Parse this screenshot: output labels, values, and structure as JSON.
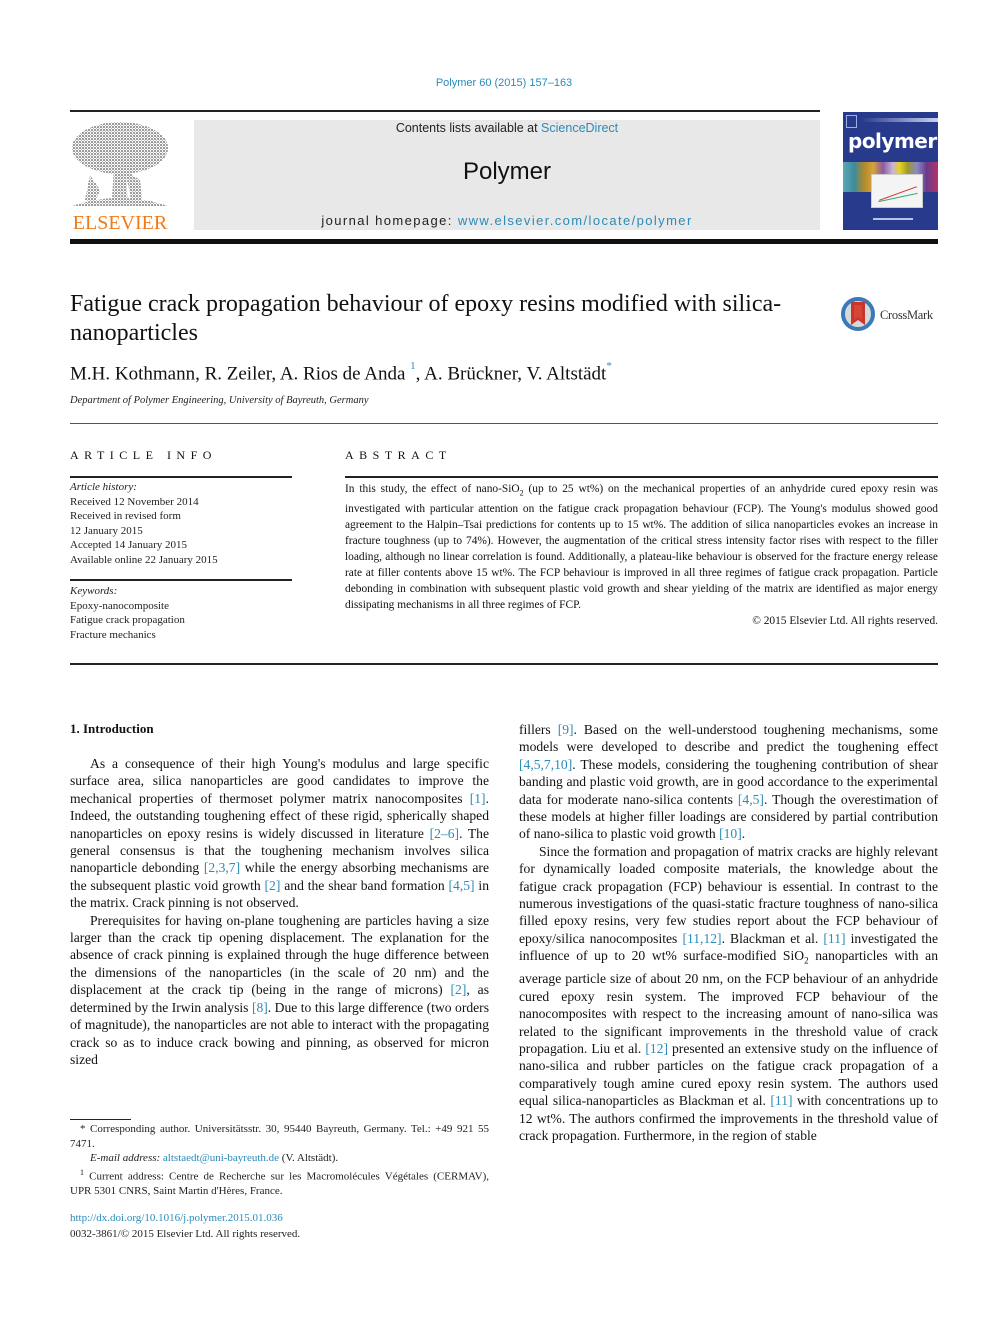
{
  "header": {
    "citation": "Polymer 60 (2015) 157–163",
    "contents_prefix": "Contents lists available at ",
    "contents_link": "ScienceDirect",
    "journal_title": "Polymer",
    "homepage_prefix": "journal homepage: ",
    "homepage_link": "www.elsevier.com/locate/polymer",
    "publisher_logo_text": "ELSEVIER",
    "cover_title": "polymer",
    "colors": {
      "link": "#2a8bb8",
      "elsevier_orange": "#f07a1a",
      "cover_blue": "#283a8c",
      "masthead_bg": "#e8e8e8"
    }
  },
  "article": {
    "title": "Fatigue crack propagation behaviour of epoxy resins modified with silica-nanoparticles",
    "crossmark_label": "CrossMark",
    "authors": [
      {
        "name": "M.H. Kothmann",
        "sup": ""
      },
      {
        "name": "R. Zeiler",
        "sup": ""
      },
      {
        "name": "A. Rios de Anda",
        "sup": "1"
      },
      {
        "name": "A. Brückner",
        "sup": ""
      },
      {
        "name": "V. Altstädt",
        "sup": "*"
      }
    ],
    "author_sep": ", ",
    "affiliation": "Department of Polymer Engineering, University of Bayreuth, Germany"
  },
  "article_info": {
    "heading": "ARTICLE INFO",
    "history_label": "Article history:",
    "history": [
      "Received 12 November 2014",
      "Received in revised form",
      "12 January 2015",
      "Accepted 14 January 2015",
      "Available online 22 January 2015"
    ],
    "keywords_label": "Keywords:",
    "keywords": [
      "Epoxy-nanocomposite",
      "Fatigue crack propagation",
      "Fracture mechanics"
    ]
  },
  "abstract": {
    "heading": "ABSTRACT",
    "text_1": "In this study, the effect of nano-SiO",
    "sub_1": "2",
    "text_2": " (up to 25 wt%) on the mechanical properties of an anhydride cured epoxy resin was investigated with particular attention on the fatigue crack propagation behaviour (FCP). The Young's modulus showed good agreement to the Halpin–Tsai predictions for contents up to 15 wt%. The addition of silica nanoparticles evokes an increase in fracture toughness (up to 74%). However, the augmentation of the critical stress intensity factor rises with respect to the filler loading, although no linear correlation is found. Additionally, a plateau-like behaviour is observed for the fracture energy release rate at filler contents above 15 wt%. The FCP behaviour is improved in all three regimes of fatigue crack propagation. Particle debonding in combination with subsequent plastic void growth and shear yielding of the matrix are identified as major energy dissipating mechanisms in all three regimes of FCP.",
    "copyright": "© 2015 Elsevier Ltd. All rights reserved."
  },
  "body": {
    "section_heading": "1.  Introduction",
    "left_col": {
      "p1": [
        {
          "t": "As a consequence of their high Young's modulus and large specific surface area, silica nanoparticles are good candidates to improve the mechanical properties of thermoset polymer matrix nanocomposites "
        },
        {
          "r": "[1]"
        },
        {
          "t": ". Indeed, the outstanding toughening effect of these rigid, spherically shaped nanoparticles on epoxy resins is widely discussed in literature "
        },
        {
          "r": "[2–6]"
        },
        {
          "t": ". The general consensus is that the toughening mechanism involves silica nanoparticle debonding "
        },
        {
          "r": "[2,3,7]"
        },
        {
          "t": " while the energy absorbing mechanisms are the subsequent plastic void growth "
        },
        {
          "r": "[2]"
        },
        {
          "t": " and the shear band formation "
        },
        {
          "r": "[4,5]"
        },
        {
          "t": " in the matrix. Crack pinning is not observed."
        }
      ],
      "p2": [
        {
          "t": "Prerequisites for having on-plane toughening are particles having a size larger than the crack tip opening displacement. The explanation for the absence of crack pinning is explained through the huge difference between the dimensions of the nanoparticles (in the scale of 20 nm) and the displacement at the crack tip (being in the range of microns) "
        },
        {
          "r": "[2]"
        },
        {
          "t": ", as determined by the Irwin analysis "
        },
        {
          "r": "[8]"
        },
        {
          "t": ". Due to this large difference (two orders of magnitude), the nanoparticles are not able to interact with the propagating crack so as to induce crack bowing and pinning, as observed for micron sized"
        }
      ]
    },
    "right_col": {
      "p1": [
        {
          "t": "fillers "
        },
        {
          "r": "[9]"
        },
        {
          "t": ". Based on the well-understood toughening mechanisms, some models were developed to describe and predict the toughening effect "
        },
        {
          "r": "[4,5,7,10]"
        },
        {
          "t": ". These models, considering the toughening contribution of shear banding and plastic void growth, are in good accordance to the experimental data for moderate nano-silica contents "
        },
        {
          "r": "[4,5]"
        },
        {
          "t": ". Though the overestimation of these models at higher filler loadings are considered by partial contribution of nano-silica to plastic void growth "
        },
        {
          "r": "[10]"
        },
        {
          "t": "."
        }
      ],
      "p2": [
        {
          "t": "Since the formation and propagation of matrix cracks are highly relevant for dynamically loaded composite materials, the knowledge about the fatigue crack propagation (FCP) behaviour is essential. In contrast to the numerous investigations of the quasi-static fracture toughness of nano-silica filled epoxy resins, very few studies report about the FCP behaviour of epoxy/silica nanocomposites "
        },
        {
          "r": "[11,12]"
        },
        {
          "t": ". Blackman et al. "
        },
        {
          "r": "[11]"
        },
        {
          "t": " investigated the influence of up to 20 wt% surface-modified SiO"
        },
        {
          "s": "2"
        },
        {
          "t": " nanoparticles with an average particle size of about 20 nm, on the FCP behaviour of an anhydride cured epoxy resin system. The improved FCP behaviour of the nanocomposites with respect to the increasing amount of nano-silica was related to the significant improvements in the threshold value of crack propagation. Liu et al. "
        },
        {
          "r": "[12]"
        },
        {
          "t": " presented an extensive study on the influence of nano-silica and rubber particles on the fatigue crack propagation of a comparatively tough amine cured epoxy resin system. The authors used equal silica-nanoparticles as Blackman et al. "
        },
        {
          "r": "[11]"
        },
        {
          "t": " with concentrations up to 12 wt%. The authors confirmed the improvements in the threshold value of crack propagation. Furthermore, in the region of stable"
        }
      ]
    }
  },
  "footnotes": {
    "corresponding": "* Corresponding author. Universitätsstr. 30, 95440 Bayreuth, Germany. Tel.: +49 921 55 7471.",
    "email_label": "E-mail address: ",
    "email": "altstaedt@uni-bayreuth.de",
    "email_suffix": " (V. Altstädt).",
    "note1_mark": "1",
    "note1": " Current address: Centre de Recherche sur les Macromolécules Végétales (CERMAV), UPR 5301 CNRS, Saint Martin d'Hères, France."
  },
  "doi": {
    "link": "http://dx.doi.org/10.1016/j.polymer.2015.01.036",
    "rights": "0032-3861/© 2015 Elsevier Ltd. All rights reserved."
  }
}
